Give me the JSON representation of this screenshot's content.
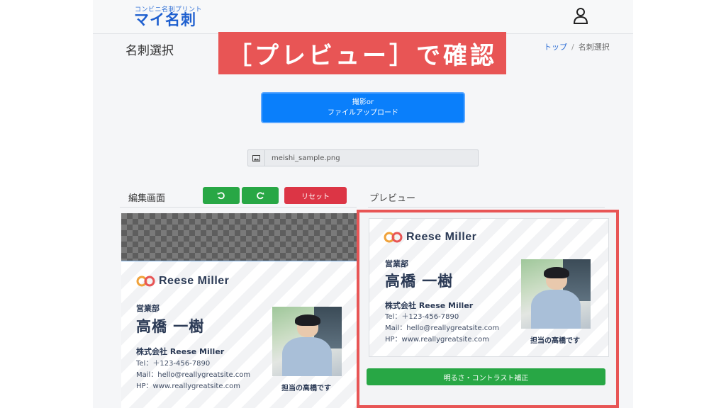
{
  "header": {
    "logo_sub": "コンビニ名刺プリント",
    "logo_main": "マイ名刺"
  },
  "page": {
    "title": "名刺選択"
  },
  "breadcrumb": {
    "home": "トップ",
    "separator": "/",
    "current": "名刺選択"
  },
  "banner": {
    "text": "［プレビュー］で確認",
    "color": "#e85555"
  },
  "upload": {
    "line1": "撮影or",
    "line2": "ファイルアップロード",
    "color": "#0a7ffb"
  },
  "file": {
    "name": "meishi_sample.png",
    "icon": "image-icon"
  },
  "editor": {
    "label": "編集画面",
    "rotate_left_icon": "rotate-ccw-icon",
    "rotate_right_icon": "rotate-cw-icon",
    "reset_label": "リセット"
  },
  "preview": {
    "label": "プレビュー",
    "adjust_label": "明るさ・コントラスト補正"
  },
  "card": {
    "brand": "Reese Miller",
    "department": "営業部",
    "name": "高橋 一樹",
    "company": "株式会社 Reese Miller",
    "tel": "Tel：＋123-456-7890",
    "mail": "Mail：hello@reallygreatsite.com",
    "hp": "HP：www.reallygreatsite.com",
    "photo_caption": "担当の高橋です"
  },
  "colors": {
    "green": "#28a745",
    "red": "#dc3545",
    "navy": "#2b3a55"
  }
}
